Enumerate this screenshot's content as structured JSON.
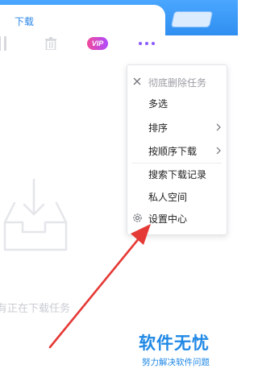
{
  "tabs": {
    "active_label": "下载"
  },
  "toolbar": {
    "vip_label": "VIP"
  },
  "empty_state": {
    "message": "有正在下载任务"
  },
  "menu": {
    "items": [
      {
        "label": "彻底删除任务",
        "icon": "close-icon",
        "disabled": true
      },
      {
        "label": "多选"
      },
      {
        "label": "排序",
        "submenu": true
      },
      {
        "label": "按顺序下载",
        "submenu": true
      },
      {
        "label": "搜索下载记录"
      },
      {
        "label": "私人空间"
      },
      {
        "label": "设置中心",
        "icon": "gear-icon"
      }
    ]
  },
  "watermark": {
    "title": "软件无忧",
    "subtitle": "努力解决软件问题"
  },
  "colors": {
    "accent": "#2f8ff0",
    "arrow": "#e53935",
    "more_dots": "#8a5cff"
  }
}
